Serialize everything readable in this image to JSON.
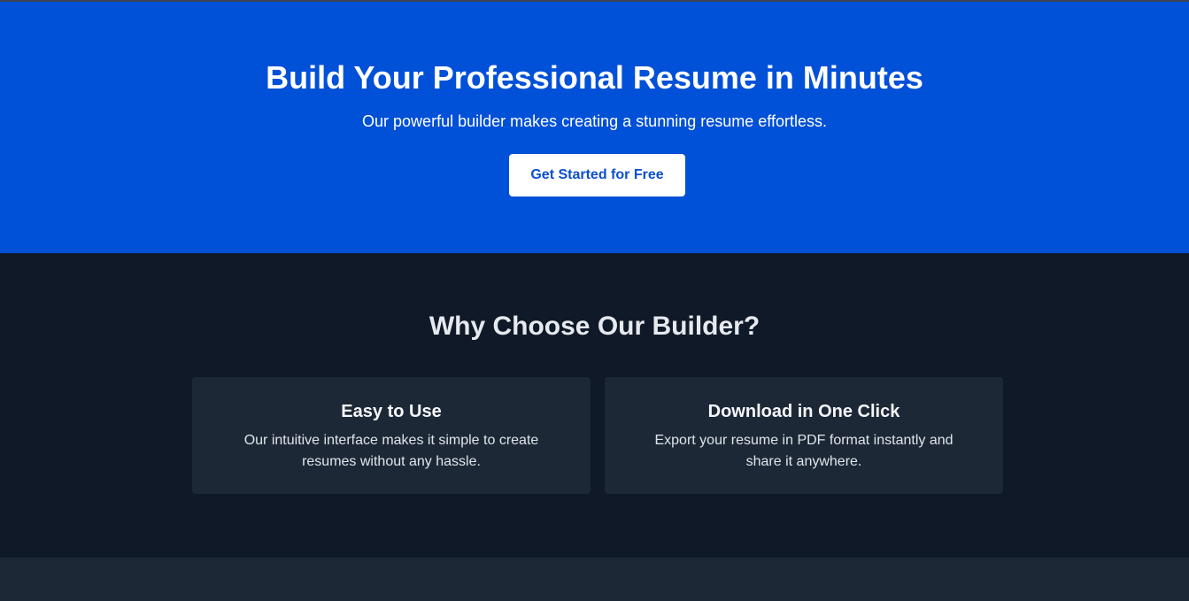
{
  "hero": {
    "title": "Build Your Professional Resume in Minutes",
    "subtitle": "Our powerful builder makes creating a stunning resume effortless.",
    "cta_label": "Get Started for Free"
  },
  "features": {
    "title": "Why Choose Our Builder?",
    "cards": [
      {
        "title": "Easy to Use",
        "text": "Our intuitive interface makes it simple to create resumes without any hassle."
      },
      {
        "title": "Download in One Click",
        "text": "Export your resume in PDF format instantly and share it anywhere."
      }
    ]
  },
  "colors": {
    "hero_background": "#0050d8",
    "features_background": "#101927",
    "card_background": "#1d2836",
    "cta_text": "#0b4fcf"
  }
}
